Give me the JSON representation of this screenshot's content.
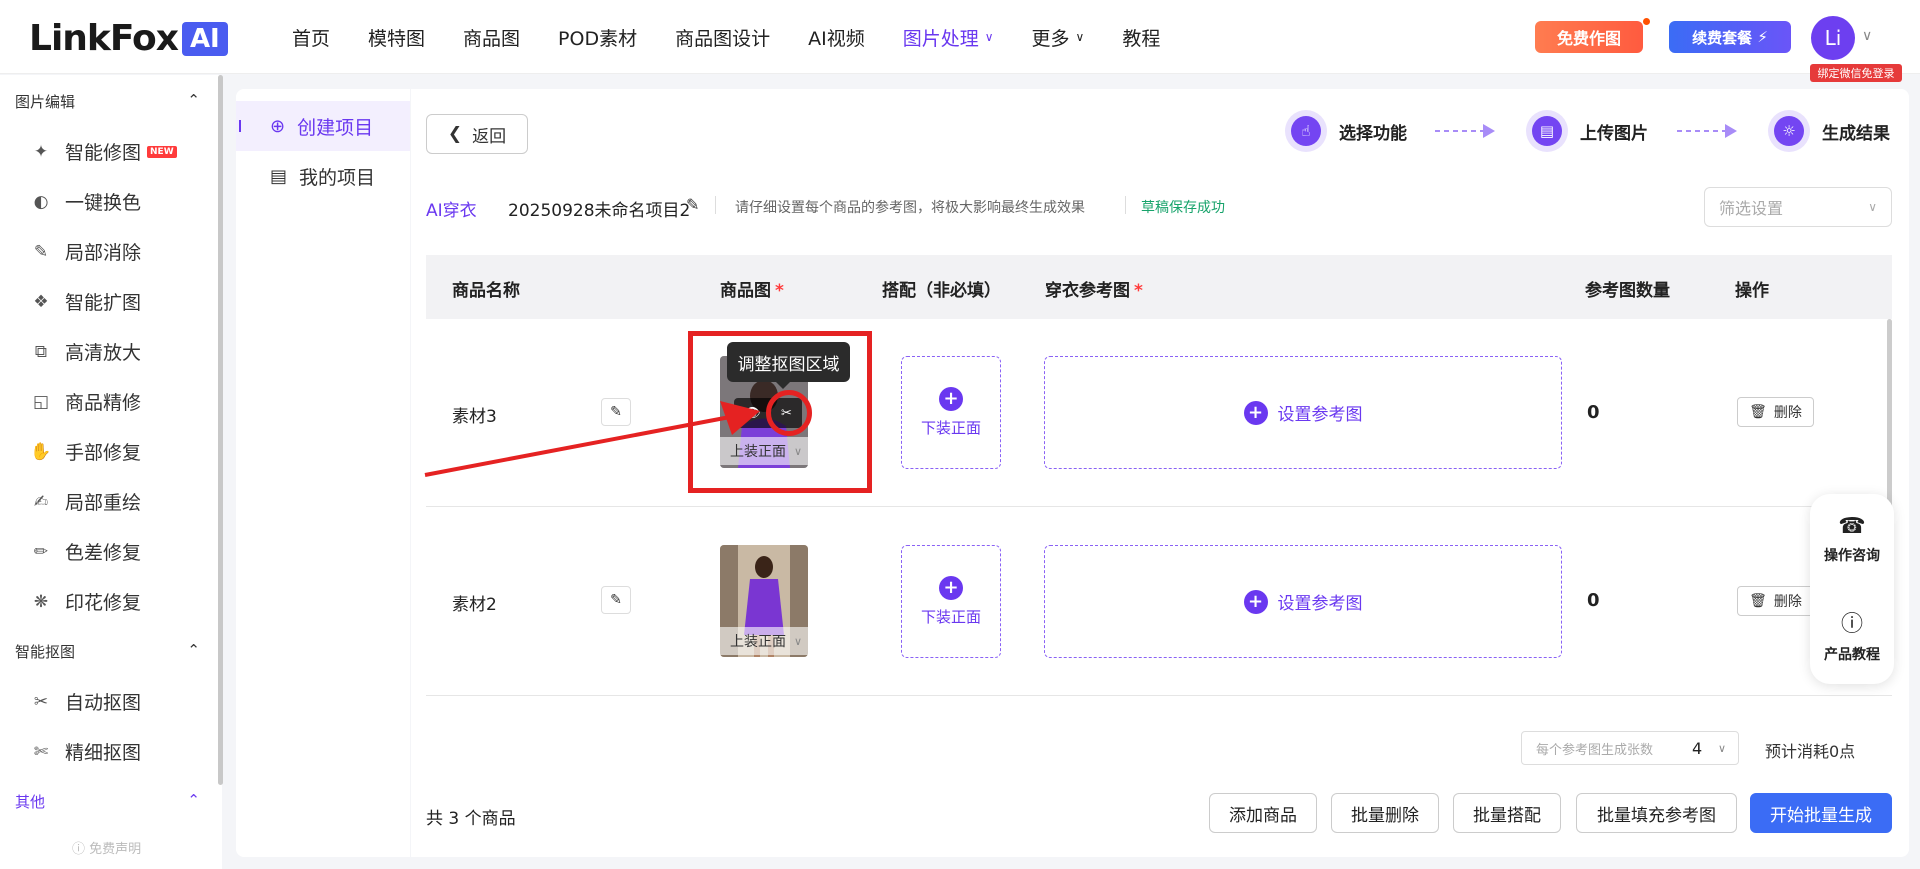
{
  "brand": {
    "logo_text": "LinkFox",
    "logo_badge": "AI"
  },
  "nav": {
    "items": [
      "首页",
      "模特图",
      "商品图",
      "POD素材",
      "商品图设计",
      "AI视频"
    ],
    "active": "图片处理",
    "more": "更多",
    "tutorial": "教程"
  },
  "header": {
    "free_btn": "免费作图",
    "renew_btn": "续费套餐",
    "avatar": "Li",
    "bind_tag": "绑定微信免登录"
  },
  "sidebar": {
    "group_edit": "图片编辑",
    "edit_items": [
      "智能修图",
      "一键换色",
      "局部消除",
      "智能扩图",
      "高清放大",
      "商品精修",
      "手部修复",
      "局部重绘",
      "色差修复",
      "印花修复"
    ],
    "new_badge": "NEW",
    "group_cutout": "智能抠图",
    "cutout_items": [
      "自动抠图",
      "精细抠图"
    ],
    "group_other": "其他",
    "disclaimer": "免费声明"
  },
  "projects": {
    "create": "创建项目",
    "mine": "我的项目"
  },
  "toolbar": {
    "back": "返回"
  },
  "steps": [
    "选择功能",
    "上传图片",
    "生成结果"
  ],
  "crumb": {
    "type": "AI穿衣",
    "name": "20250928未命名项目2",
    "tip": "请仔细设置每个商品的参考图，将极大影响最终生成效果",
    "saved": "草稿保存成功"
  },
  "filter": {
    "placeholder": "筛选设置"
  },
  "table": {
    "headers": {
      "name": "商品名称",
      "image": "商品图",
      "match": "搭配（非必填）",
      "ref": "穿衣参考图",
      "count": "参考图数量",
      "action": "操作"
    },
    "required_mark": "*",
    "rows": [
      {
        "name": "素材3",
        "thumb_label": "上装正面",
        "match_label": "下装正面",
        "ref_label": "设置参考图",
        "count": "0",
        "delete": "删除"
      },
      {
        "name": "素材2",
        "thumb_label": "上装正面",
        "match_label": "下装正面",
        "ref_label": "设置参考图",
        "count": "0",
        "delete": "删除"
      }
    ]
  },
  "tooltip": "调整抠图区域",
  "float": {
    "consult": "操作咨询",
    "tutorial": "产品教程"
  },
  "footer": {
    "per_gen_label": "每个参考图生成张数",
    "per_gen_value": "4",
    "cost": "预计消耗0点",
    "total": "共 3 个商品",
    "buttons": [
      "添加商品",
      "批量删除",
      "批量搭配",
      "批量填充参考图",
      "开始批量生成"
    ]
  },
  "colors": {
    "accent": "#6a38f0",
    "primary": "#3b6cf5",
    "annotation": "#e52222"
  }
}
